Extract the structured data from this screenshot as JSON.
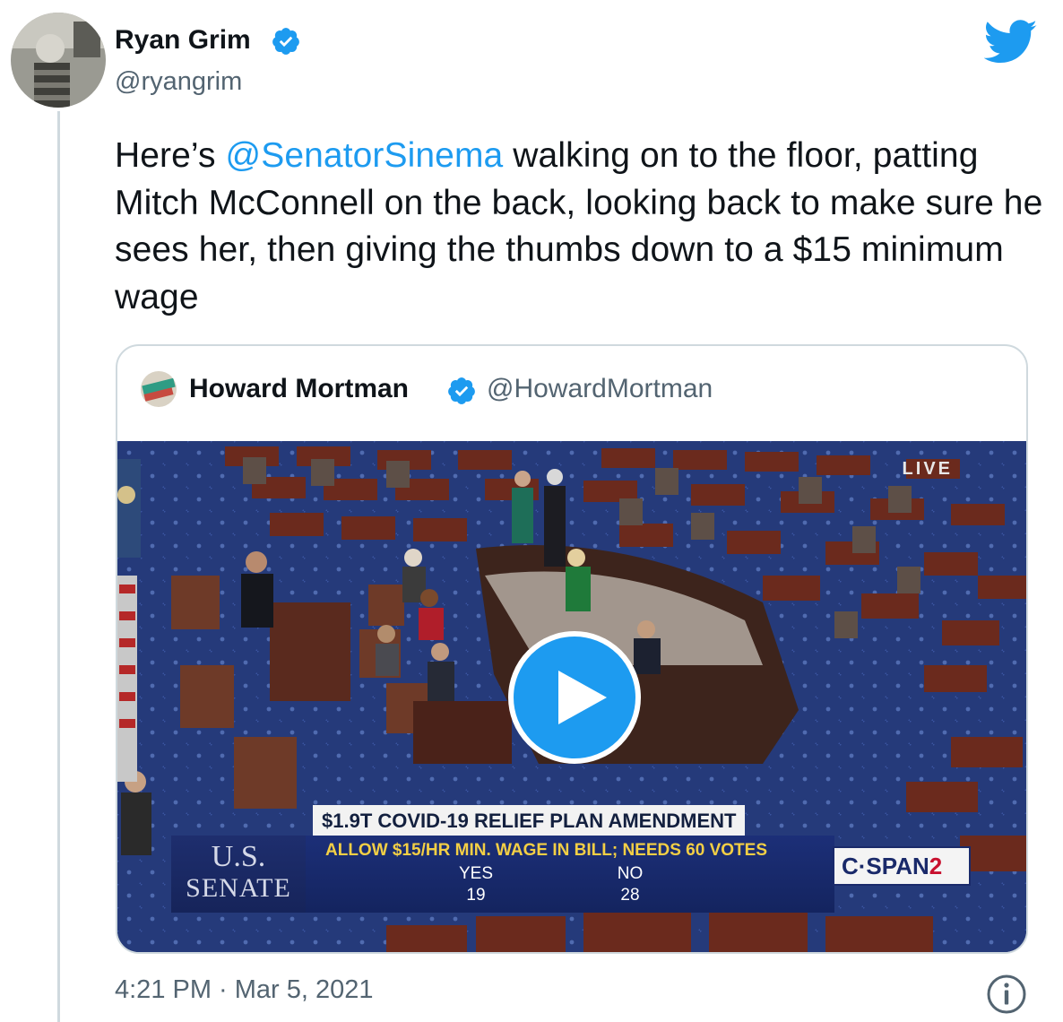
{
  "author": {
    "name": "Ryan Grim",
    "handle": "@ryangrim"
  },
  "tweet": {
    "text_before": "Here’s ",
    "mention": "@SenatorSinema",
    "text_after": " walking on to the floor, patting Mitch McConnell on the back, looking back to make sure he sees her, then giving the thumbs down to a $15 minimum wage"
  },
  "quote": {
    "name": "Howard Mortman",
    "handle": "@HowardMortman",
    "video": {
      "live_label": "LIVE",
      "chyron_title": "$1.9T COVID-19 RELIEF PLAN AMENDMENT",
      "chyron_line": "ALLOW $15/HR MIN. WAGE IN BILL; NEEDS 60 VOTES",
      "yes_label": "YES",
      "yes_count": "19",
      "no_label": "NO",
      "no_count": "28",
      "senate_us": "U.S.",
      "senate_word": "SENATE",
      "network_prefix": "C·SPAN",
      "network_suffix": "2"
    }
  },
  "footer": {
    "timestamp": "4:21 PM · Mar 5, 2021"
  },
  "icons": {
    "brand": "twitter-bird-icon",
    "verified": "verified-badge-icon",
    "play": "play-icon",
    "info": "info-icon"
  },
  "colors": {
    "accent": "#1d9bf0",
    "text": "#0f1419",
    "secondary": "#536471",
    "border": "#cfd9de"
  }
}
